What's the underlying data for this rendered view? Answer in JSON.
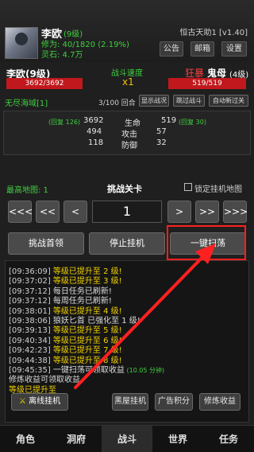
{
  "header": {
    "player_name": "李欧",
    "player_level": "(9级)",
    "cultivation": "修为: 40/1820 (2.19%)",
    "spirit_stone": "灵石: 4.7万",
    "server": "恒古天助1 [v1.40]",
    "buttons": {
      "notice": "公告",
      "mail": "邮箱",
      "settings": "设置"
    }
  },
  "battle": {
    "me_name": "李欧(9级)",
    "me_hp": "3692/3692",
    "speed_label": "战斗速度",
    "speed_value": "x1",
    "enemy_tag": "狂暴",
    "enemy_name": "鬼母",
    "enemy_level": "(4级)",
    "enemy_hp": "519/519",
    "map_name": "无尽海域[1]",
    "round": "3/100 回合",
    "buttons": {
      "show": "显示战况",
      "skip": "跳过战斗",
      "auto": "自动新过关"
    }
  },
  "stats": {
    "my_recover": "(回复 126)",
    "my_hp": "3692",
    "my_attack": "494",
    "my_defense": "118",
    "label_hp": "生命",
    "label_attack": "攻击",
    "label_defense": "防御",
    "enemy_hp": "519",
    "enemy_attack": "57",
    "enemy_defense": "32",
    "enemy_recover": "(回复 30)"
  },
  "challenge": {
    "max_map": "最高地图: 1",
    "title": "挑战关卡",
    "lock_label": "锁定挂机地图",
    "stage": "1",
    "nav": [
      "<<<",
      "<<",
      "<",
      ">",
      ">>",
      ">>>"
    ],
    "btn_boss": "挑战首领",
    "btn_stop": "停止挂机",
    "btn_sweep": "一键扫荡"
  },
  "log": [
    {
      "time": "[09:36:09]",
      "text": "等级已提升至 2 级!",
      "hl": true
    },
    {
      "time": "[09:37:02]",
      "text": "等级已提升至 3 级!",
      "hl": true
    },
    {
      "time": "[09:37:12]",
      "text": "每日任务已刷新!",
      "hl": false
    },
    {
      "time": "[09:37:12]",
      "text": "每周任务已刷新!",
      "hl": false
    },
    {
      "time": "[09:38:01]",
      "text": "等级已提升至 4 级!",
      "hl": true
    },
    {
      "time": "[09:38:06]",
      "text": "狼妖匕首 已强化至 1 级!",
      "hl": false
    },
    {
      "time": "[09:39:13]",
      "text": "等级已提升至 5 级!",
      "hl": true
    },
    {
      "time": "[09:40:34]",
      "text": "等级已提升至 6 级!",
      "hl": true
    },
    {
      "time": "[09:42:23]",
      "text": "等级已提升至 7 级!",
      "hl": true
    },
    {
      "time": "[09:44:38]",
      "text": "等级已提升至 8 级!",
      "hl": true
    },
    {
      "time": "[09:45:35]",
      "text": "一键扫荡可领取收益",
      "extra": "(10.05 分钟)",
      "hl": false
    },
    {
      "time": "",
      "text": "修炼收益可领取收益",
      "hl": false
    },
    {
      "time": "",
      "text": "等级已提升至",
      "hl": true
    }
  ],
  "bottom_buttons": {
    "offline": "离线挂机",
    "blackhouse": "黑屋挂机",
    "adpoints": "广告积分",
    "income": "修炼收益"
  },
  "tabs": [
    "角色",
    "洞府",
    "战斗",
    "世界",
    "任务"
  ],
  "colors": {
    "green": "#3fcf3f",
    "yellow": "#f0d000",
    "red": "#c0181c",
    "highlight_red": "#ff2020"
  }
}
